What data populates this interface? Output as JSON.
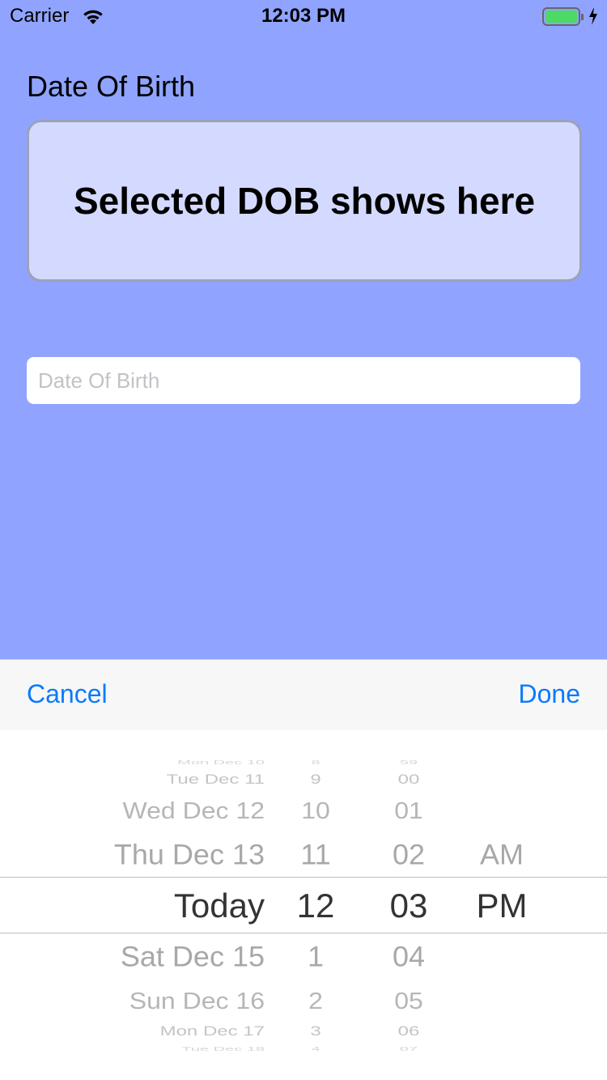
{
  "status_bar": {
    "carrier": "Carrier",
    "time": "12:03 PM"
  },
  "form": {
    "label": "Date Of Birth",
    "selected_display": "Selected DOB shows here",
    "input_placeholder": "Date Of Birth",
    "input_value": ""
  },
  "toolbar": {
    "cancel_label": "Cancel",
    "done_label": "Done"
  },
  "picker": {
    "day_column": [
      "Mon Dec 10",
      "Tue Dec 11",
      "Wed Dec 12",
      "Thu Dec 13",
      "Today",
      "Sat Dec 15",
      "Sun Dec 16",
      "Mon Dec 17",
      "Tue Dec 18"
    ],
    "hour_column": [
      "8",
      "9",
      "10",
      "11",
      "12",
      "1",
      "2",
      "3",
      "4"
    ],
    "minute_column": [
      "59",
      "00",
      "01",
      "02",
      "03",
      "04",
      "05",
      "06",
      "07"
    ],
    "ampm_column": [
      "",
      "",
      "",
      "AM",
      "PM",
      "",
      "",
      "",
      ""
    ],
    "selected_index": 4
  },
  "colors": {
    "background": "#90a4ff",
    "accent": "#0a7aff",
    "battery": "#4cd964"
  }
}
